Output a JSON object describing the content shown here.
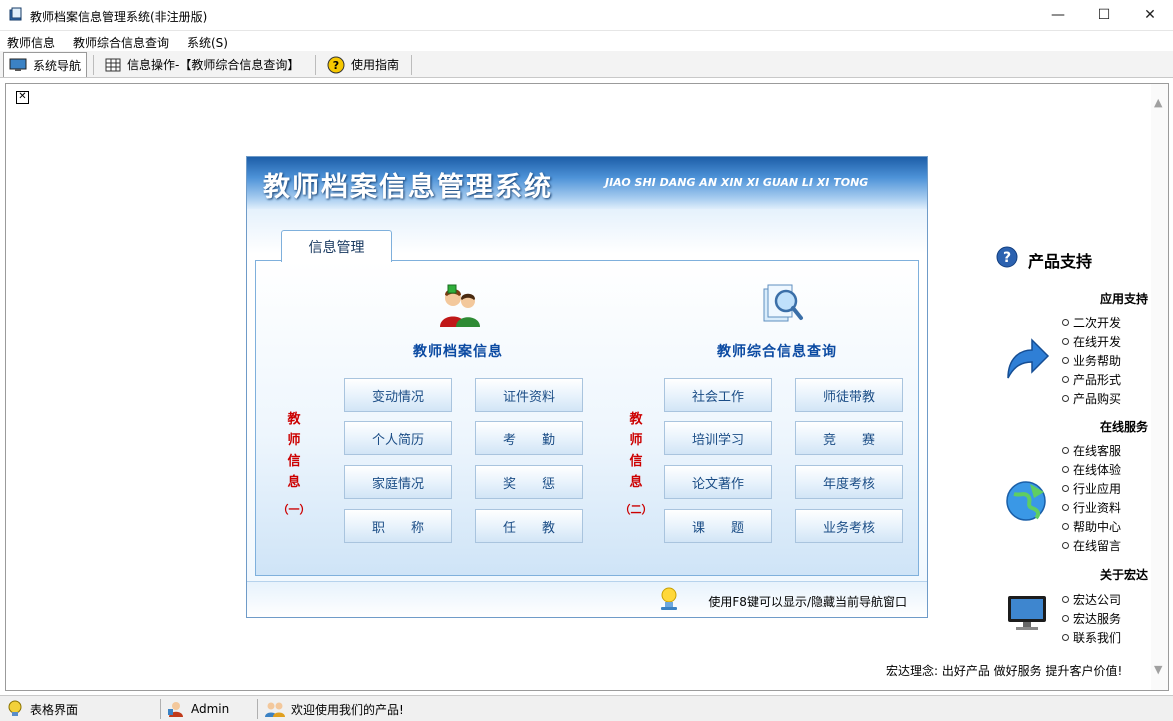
{
  "window": {
    "title": "教师档案信息管理系统(非注册版)",
    "minimize": "—",
    "maximize": "☐",
    "close": "✕"
  },
  "menu": [
    "教师信息",
    "教师综合信息查询",
    "系统(S)"
  ],
  "toolbar": {
    "nav": "系统导航",
    "info_op": "信息操作-【教师综合信息查询】",
    "guide": "使用指南"
  },
  "panel": {
    "title_cn": "教师档案信息管理系统",
    "title_en": "JIAO SHI DANG AN XIN XI GUAN LI XI TONG",
    "tab": "信息管理",
    "left_section": "教师档案信息",
    "right_section": "教师综合信息查询",
    "left_vertical": [
      "教",
      "师",
      "信",
      "息"
    ],
    "left_paren": "（一）",
    "right_vertical": [
      "教",
      "师",
      "信",
      "息"
    ],
    "right_paren": "（二）",
    "buttons_left": [
      "变动情况",
      "证件资料",
      "个人简历",
      "考　　勤",
      "家庭情况",
      "奖　　惩",
      "职　　称",
      "任　　教"
    ],
    "buttons_right": [
      "社会工作",
      "师徒带教",
      "培训学习",
      "竞　　赛",
      "论文著作",
      "年度考核",
      "课　　题",
      "业务考核"
    ],
    "hint": "使用F8键可以显示/隐藏当前导航窗口"
  },
  "support": {
    "title": "产品支持",
    "groups": [
      {
        "name": "应用支持",
        "items": [
          "二次开发",
          "在线开发",
          "业务帮助",
          "产品形式",
          "产品购买"
        ]
      },
      {
        "name": "在线服务",
        "items": [
          "在线客服",
          "在线体验",
          "行业应用",
          "行业资料",
          "帮助中心",
          "在线留言"
        ]
      },
      {
        "name": "关于宏达",
        "items": [
          "宏达公司",
          "宏达服务",
          "联系我们"
        ]
      }
    ],
    "motto": "宏达理念: 出好产品 做好服务 提升客户价值!"
  },
  "status": {
    "view": "表格界面",
    "user": "Admin",
    "welcome": "欢迎使用我们的产品!"
  },
  "colors": {
    "banner": "#1d5ea8",
    "section_title": "#0b4aa2",
    "vertical_label": "#cc0000",
    "button_text": "#1b4d86"
  }
}
